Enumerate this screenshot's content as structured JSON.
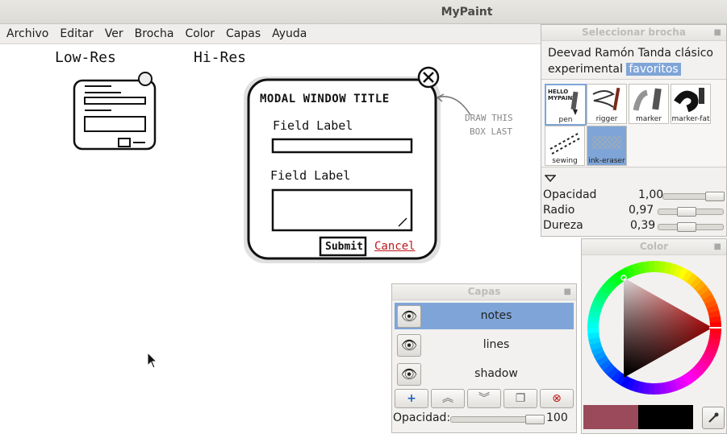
{
  "window": {
    "title": "MyPaint"
  },
  "menu": [
    "Archivo",
    "Editar",
    "Ver",
    "Brocha",
    "Color",
    "Capas",
    "Ayuda"
  ],
  "sketch": {
    "lowres": "Low-Res",
    "hires": "Hi-Res",
    "modal_title": "MODAL WINDOW TITLE",
    "field1": "Field Label",
    "field2": "Field Label",
    "submit": "Submit",
    "cancel": "Cancel",
    "annotation_line1": "DRAW THIS",
    "annotation_line2": "BOX LAST"
  },
  "brush_panel": {
    "title": "Seleccionar brocha",
    "groups": [
      "Deevad",
      "Ramón",
      "Tanda",
      "clásico",
      "experimental",
      "favoritos"
    ],
    "selected_group": "favoritos",
    "brushes": [
      "pen",
      "rigger",
      "marker",
      "marker-fat",
      "sewing",
      "ink-eraser"
    ],
    "pen_sample_text": "HELLO MYPAINT",
    "settings": [
      {
        "label": "Opacidad",
        "value": "1,00",
        "level": 1.0
      },
      {
        "label": "Radio",
        "value": "0,97",
        "level": 0.4
      },
      {
        "label": "Dureza",
        "value": "0,39",
        "level": 0.39
      }
    ]
  },
  "layers_panel": {
    "title": "Capas",
    "layers": [
      "notes",
      "lines",
      "shadow"
    ],
    "selected": "notes",
    "opacity_label": "Opacidad:",
    "opacity_value": "100",
    "buttons": [
      "add-layer",
      "move-layer-up",
      "move-layer-down",
      "duplicate-layer",
      "delete-layer"
    ]
  },
  "color_panel": {
    "title": "Color",
    "current_color": "#9a4a5a",
    "previous_color": "#000000",
    "hue": "#e00000"
  },
  "colors": {
    "selection": "#7fa5d8",
    "cancel_red": "#c0161c"
  }
}
